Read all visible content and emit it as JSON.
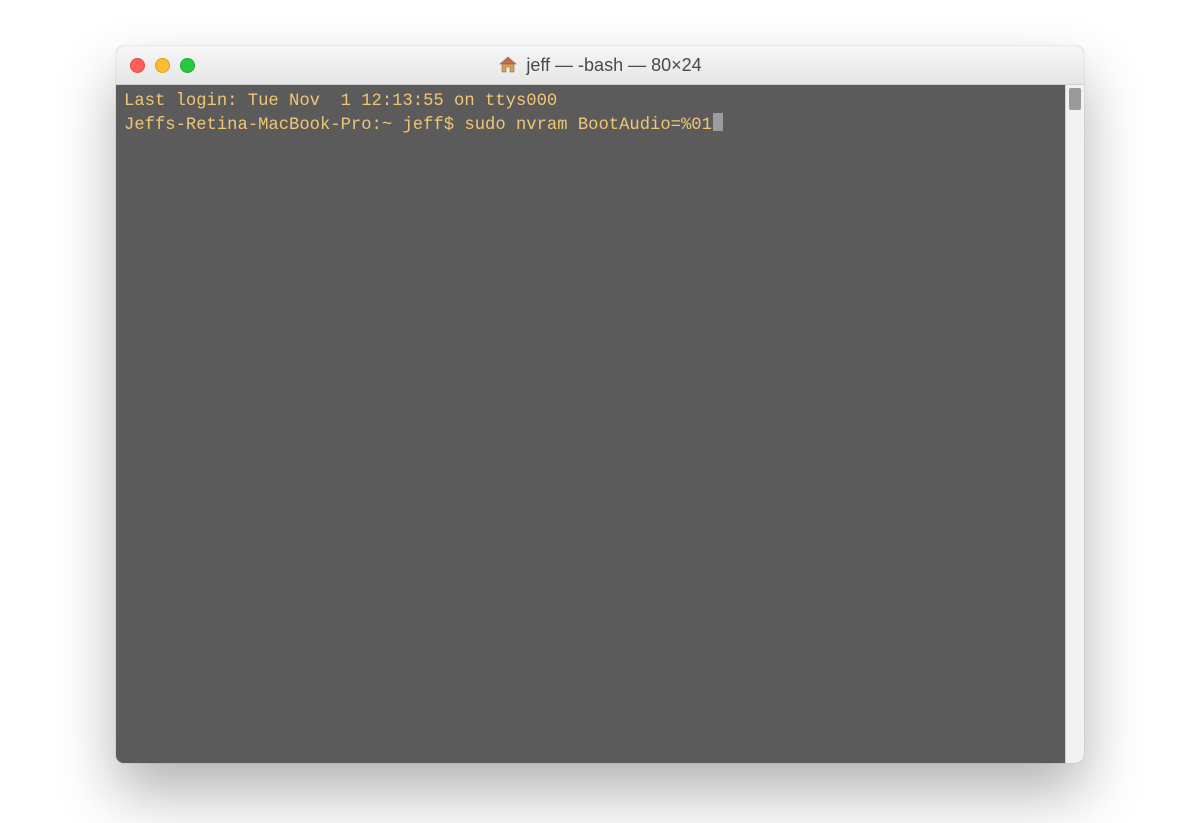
{
  "window": {
    "title": "jeff — -bash — 80×24",
    "icon_name": "home-icon"
  },
  "traffic_lights": {
    "close": "close",
    "minimize": "minimize",
    "zoom": "zoom"
  },
  "terminal": {
    "line1": "Last login: Tue Nov  1 12:13:55 on ttys000",
    "prompt": "Jeffs-Retina-MacBook-Pro:~ jeff$ ",
    "command": "sudo nvram BootAudio=%01",
    "text_color": "#f0c674",
    "background_color": "#5b5b5b"
  }
}
